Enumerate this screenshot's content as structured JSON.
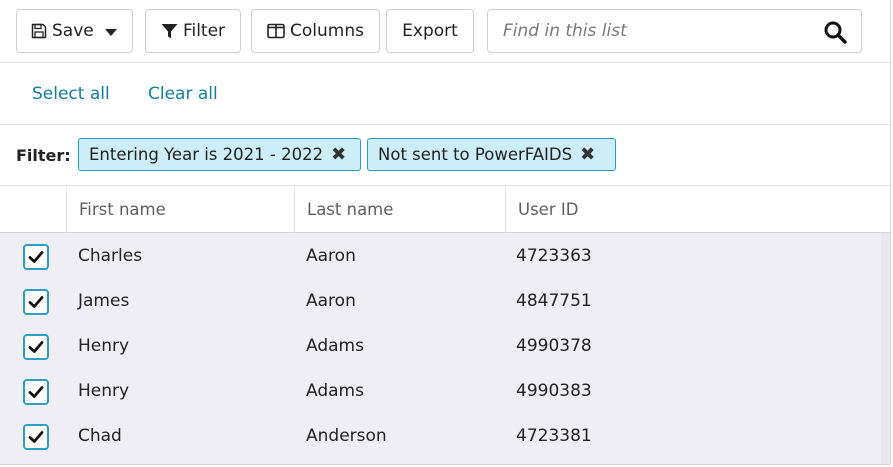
{
  "toolbar": {
    "save_label": "Save",
    "filter_label": "Filter",
    "columns_label": "Columns",
    "export_label": "Export",
    "search_placeholder": "Find in this list",
    "icons": {
      "save": "floppy-disk-icon",
      "filter": "funnel-icon",
      "columns": "columns-icon",
      "search": "magnifier-icon"
    }
  },
  "selection": {
    "select_all": "Select all",
    "clear_all": "Clear all"
  },
  "filters": {
    "label": "Filter:",
    "chips": [
      {
        "label": "Entering Year is 2021 - 2022",
        "remove": "✖"
      },
      {
        "label": "Not sent to PowerFAIDS",
        "remove": "✖"
      }
    ]
  },
  "table": {
    "columns": [
      "First name",
      "Last name",
      "User ID"
    ],
    "rows": [
      {
        "checked": true,
        "first": "Charles",
        "last": "Aaron",
        "id": "4723363"
      },
      {
        "checked": true,
        "first": "James",
        "last": "Aaron",
        "id": "4847751"
      },
      {
        "checked": true,
        "first": "Henry",
        "last": "Adams",
        "id": "4990378"
      },
      {
        "checked": true,
        "first": "Henry",
        "last": "Adams",
        "id": "4990383"
      },
      {
        "checked": true,
        "first": "Chad",
        "last": "Anderson",
        "id": "4723381"
      }
    ]
  },
  "colors": {
    "accent": "#137e9c",
    "chip_bg": "#cdeef9",
    "chip_border": "#2a9bc1",
    "checkbox_border": "#2d9fc7",
    "selected_row_bg": "#f0eef5"
  }
}
